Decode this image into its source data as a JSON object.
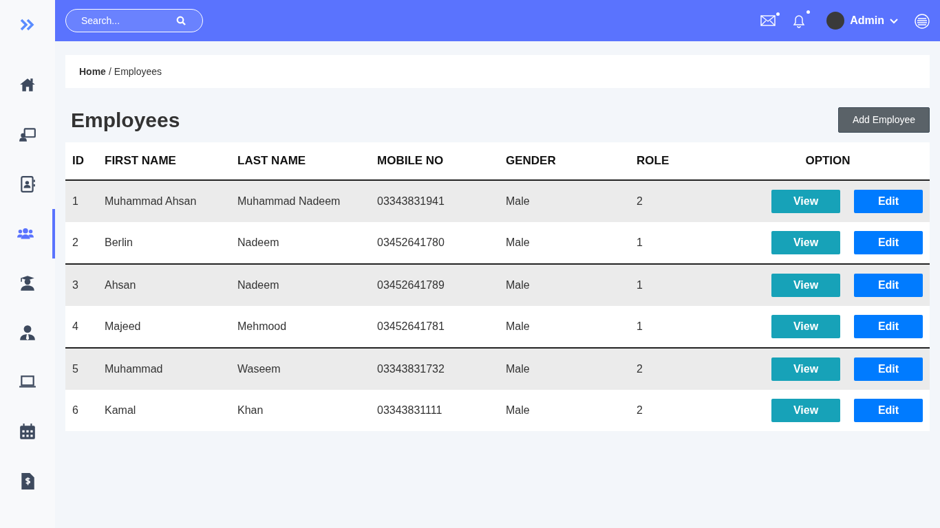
{
  "sidebar": {
    "items": [
      {
        "selected": false
      },
      {
        "selected": false
      },
      {
        "selected": false
      },
      {
        "selected": true
      },
      {
        "selected": false
      },
      {
        "selected": false
      },
      {
        "selected": false
      },
      {
        "selected": false
      },
      {
        "selected": false
      }
    ]
  },
  "topbar": {
    "search": {
      "placeholder": "Search..."
    },
    "mail": {
      "badge": true
    },
    "notifications": {
      "badge": true
    },
    "user": {
      "name": "Admin"
    }
  },
  "breadcrumb": {
    "separator": "/",
    "items": [
      {
        "label": "Home"
      },
      {
        "label": "Employees"
      }
    ]
  },
  "page_title": "Employees",
  "add_button": "Add Employee",
  "table": {
    "columns": [
      "ID",
      "FIRST NAME",
      "LAST NAME",
      "MOBILE NO",
      "GENDER",
      "ROLE",
      "OPTION"
    ],
    "rows": [
      {
        "cells": [
          "1",
          "Muhammad Ahsan",
          "Muhammad Nadeem",
          "03343831941",
          "Male",
          "2"
        ],
        "actions": [
          "View",
          "Edit"
        ]
      },
      {
        "cells": [
          "2",
          "Berlin",
          "Nadeem",
          "03452641780",
          "Male",
          "1"
        ],
        "actions": [
          "View",
          "Edit"
        ]
      },
      {
        "cells": [
          "3",
          "Ahsan",
          "Nadeem",
          "03452641789",
          "Male",
          "1"
        ],
        "actions": [
          "View",
          "Edit"
        ]
      },
      {
        "cells": [
          "4",
          "Majeed",
          "Mehmood",
          "03452641781",
          "Male",
          "1"
        ],
        "actions": [
          "View",
          "Edit"
        ]
      },
      {
        "cells": [
          "5",
          "Muhammad",
          "Waseem",
          "03343831732",
          "Male",
          "2"
        ],
        "actions": [
          "View",
          "Edit"
        ]
      },
      {
        "cells": [
          "6",
          "Kamal",
          "Khan",
          "03343831111",
          "Male",
          "2"
        ],
        "actions": [
          "View",
          "Edit"
        ]
      }
    ]
  }
}
